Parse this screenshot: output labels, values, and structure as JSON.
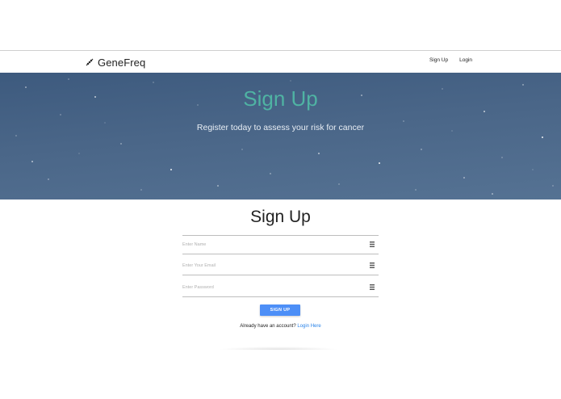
{
  "navbar": {
    "brand": "GeneFreq",
    "brand_icon": "dna-icon",
    "links": [
      "Sign Up",
      "Login"
    ]
  },
  "hero": {
    "title": "Sign Up",
    "subtitle": "Register today to assess your risk for cancer"
  },
  "form": {
    "title": "Sign Up",
    "fields": [
      {
        "placeholder": "Enter Name",
        "value": "",
        "icon": "list-icon"
      },
      {
        "placeholder": "Enter Your Email",
        "value": "",
        "icon": "list-icon"
      },
      {
        "placeholder": "Enter Password",
        "value": "",
        "icon": "list-icon"
      }
    ],
    "submit_label": "SIGN UP",
    "login_prompt": "Already have an account?",
    "login_link": "Login Here"
  },
  "colors": {
    "accent": "#4fb3a3",
    "button": "#4d8ff7",
    "link": "#2a83e8",
    "hero_bg": "#4a6688"
  }
}
